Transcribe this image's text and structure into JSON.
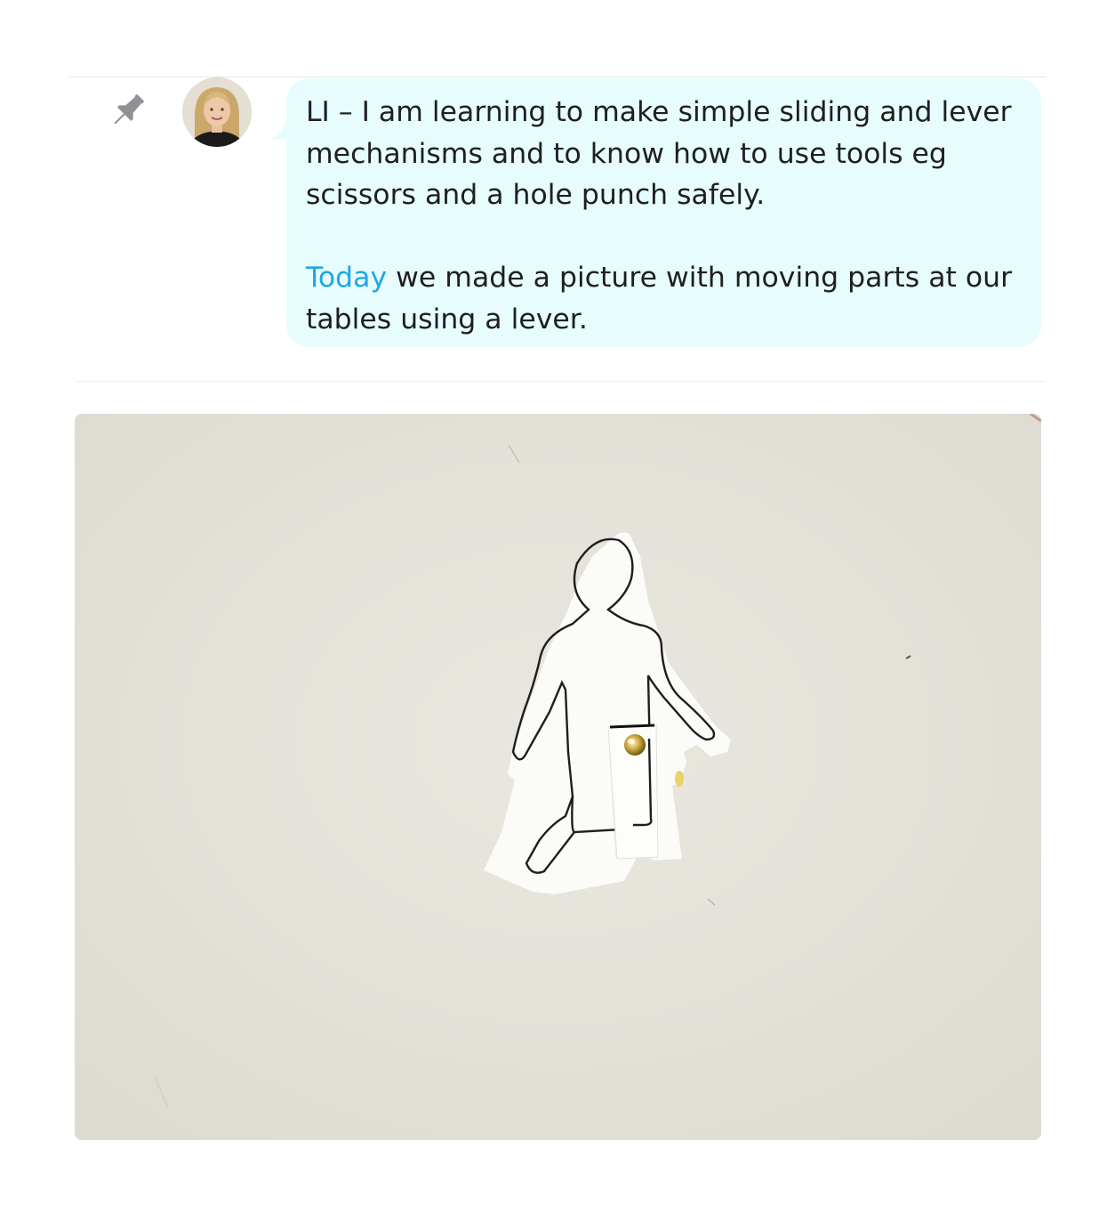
{
  "post": {
    "learning_intention": "LI – I am learning to make simple sliding and lever mechanisms and to know how to use tools eg scissors and a hole punch safely.",
    "description_highlight": "Today",
    "description_rest": " we made a picture with moving parts at our tables using a lever."
  },
  "icons": {
    "pin": "pin-icon",
    "avatar": "teacher-avatar"
  },
  "colors": {
    "bubble_background": "#e7fcfc",
    "highlight_text": "#1ea7e6",
    "pin_icon": "#8e9094"
  }
}
